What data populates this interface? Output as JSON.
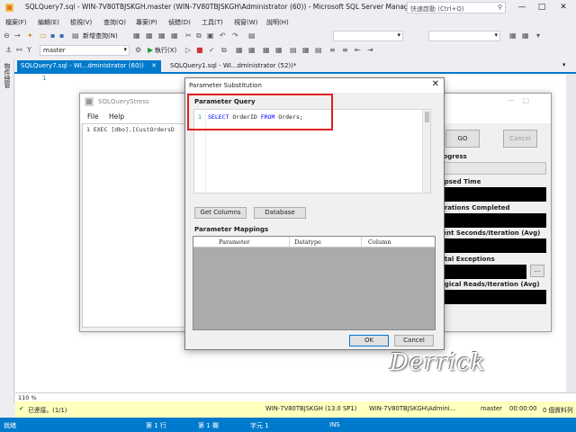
{
  "window": {
    "title": "SQLQuery7.sql - WIN-7V80TBJSKGH.master (WIN-7V80TBJSKGH\\Administrator (60)) - Microsoft SQL Server Managem...",
    "quick_launch_placeholder": "快速啟動 (Ctrl+Q)",
    "minimize": "—",
    "maximize": "□",
    "close": "✕"
  },
  "menu": [
    "檔案(F)",
    "編輯(E)",
    "檢視(V)",
    "查詢(Q)",
    "專案(P)",
    "偵錯(D)",
    "工具(T)",
    "視窗(W)",
    "說明(H)"
  ],
  "toolbar": {
    "new_query": "新增查詢(N)",
    "database": "master",
    "execute": "執行(X)",
    "debug_icon": "▶"
  },
  "sidebar_label": "物件總管",
  "tabs": {
    "active": "SQLQuery7.sql - WI...dministrator (60))",
    "other": "SQLQuery1.sql - WI...dministrator (52))*"
  },
  "editor": {
    "line_number": "1"
  },
  "zoom": "110 %",
  "resultbar": {
    "connected": "已連接。(1/1)",
    "server": "WIN-7V80TBJSKGH (13.0 SP1)",
    "user": "WIN-7V80TBJSKGH\\Admini...",
    "db": "master",
    "time": "00:00:00",
    "rows": "0 個資料列"
  },
  "statusbar": {
    "ready": "就緒",
    "line": "第 1 行",
    "col": "第 1 欄",
    "char": "字元 1",
    "mode": "INS"
  },
  "sqlquerystress": {
    "title": "SQLQueryStress",
    "menu_file": "File",
    "menu_help": "Help",
    "query_line": "1 EXEC [dbo].[CustOrdersD",
    "go": "GO",
    "cancel": "Cancel",
    "labels": [
      "Progress",
      "Elapsed Time",
      "Iterations Completed",
      "Client Seconds/Iteration (Avg)",
      "Total Exceptions",
      "Logical Reads/Iteration (Avg)"
    ],
    "label_visible": [
      "rogress",
      "apsed Time",
      "erations Completed",
      "ient Seconds/Iteration (Avg)",
      "otal Exceptions",
      "ogical Reads/Iteration (Avg)"
    ],
    "ellipsis": "..."
  },
  "dialog": {
    "title": "Parameter Substitution",
    "close": "✕",
    "param_query_label": "Parameter Query",
    "code_line": "1",
    "code_select": "SELECT",
    "code_mid": " OrderID ",
    "code_from": "FROM",
    "code_end": " Orders;",
    "get_columns": "Get Columns",
    "database": "Database",
    "param_mappings_label": "Parameter Mappings",
    "columns": [
      "Parameter",
      "Datatype",
      "Column"
    ],
    "ok": "OK",
    "cancel": "Cancel"
  },
  "watermark": "Derrick",
  "colors": {
    "accent": "#007ACC",
    "highlight": "#E02020",
    "result_bar": "#FFFFBE"
  }
}
